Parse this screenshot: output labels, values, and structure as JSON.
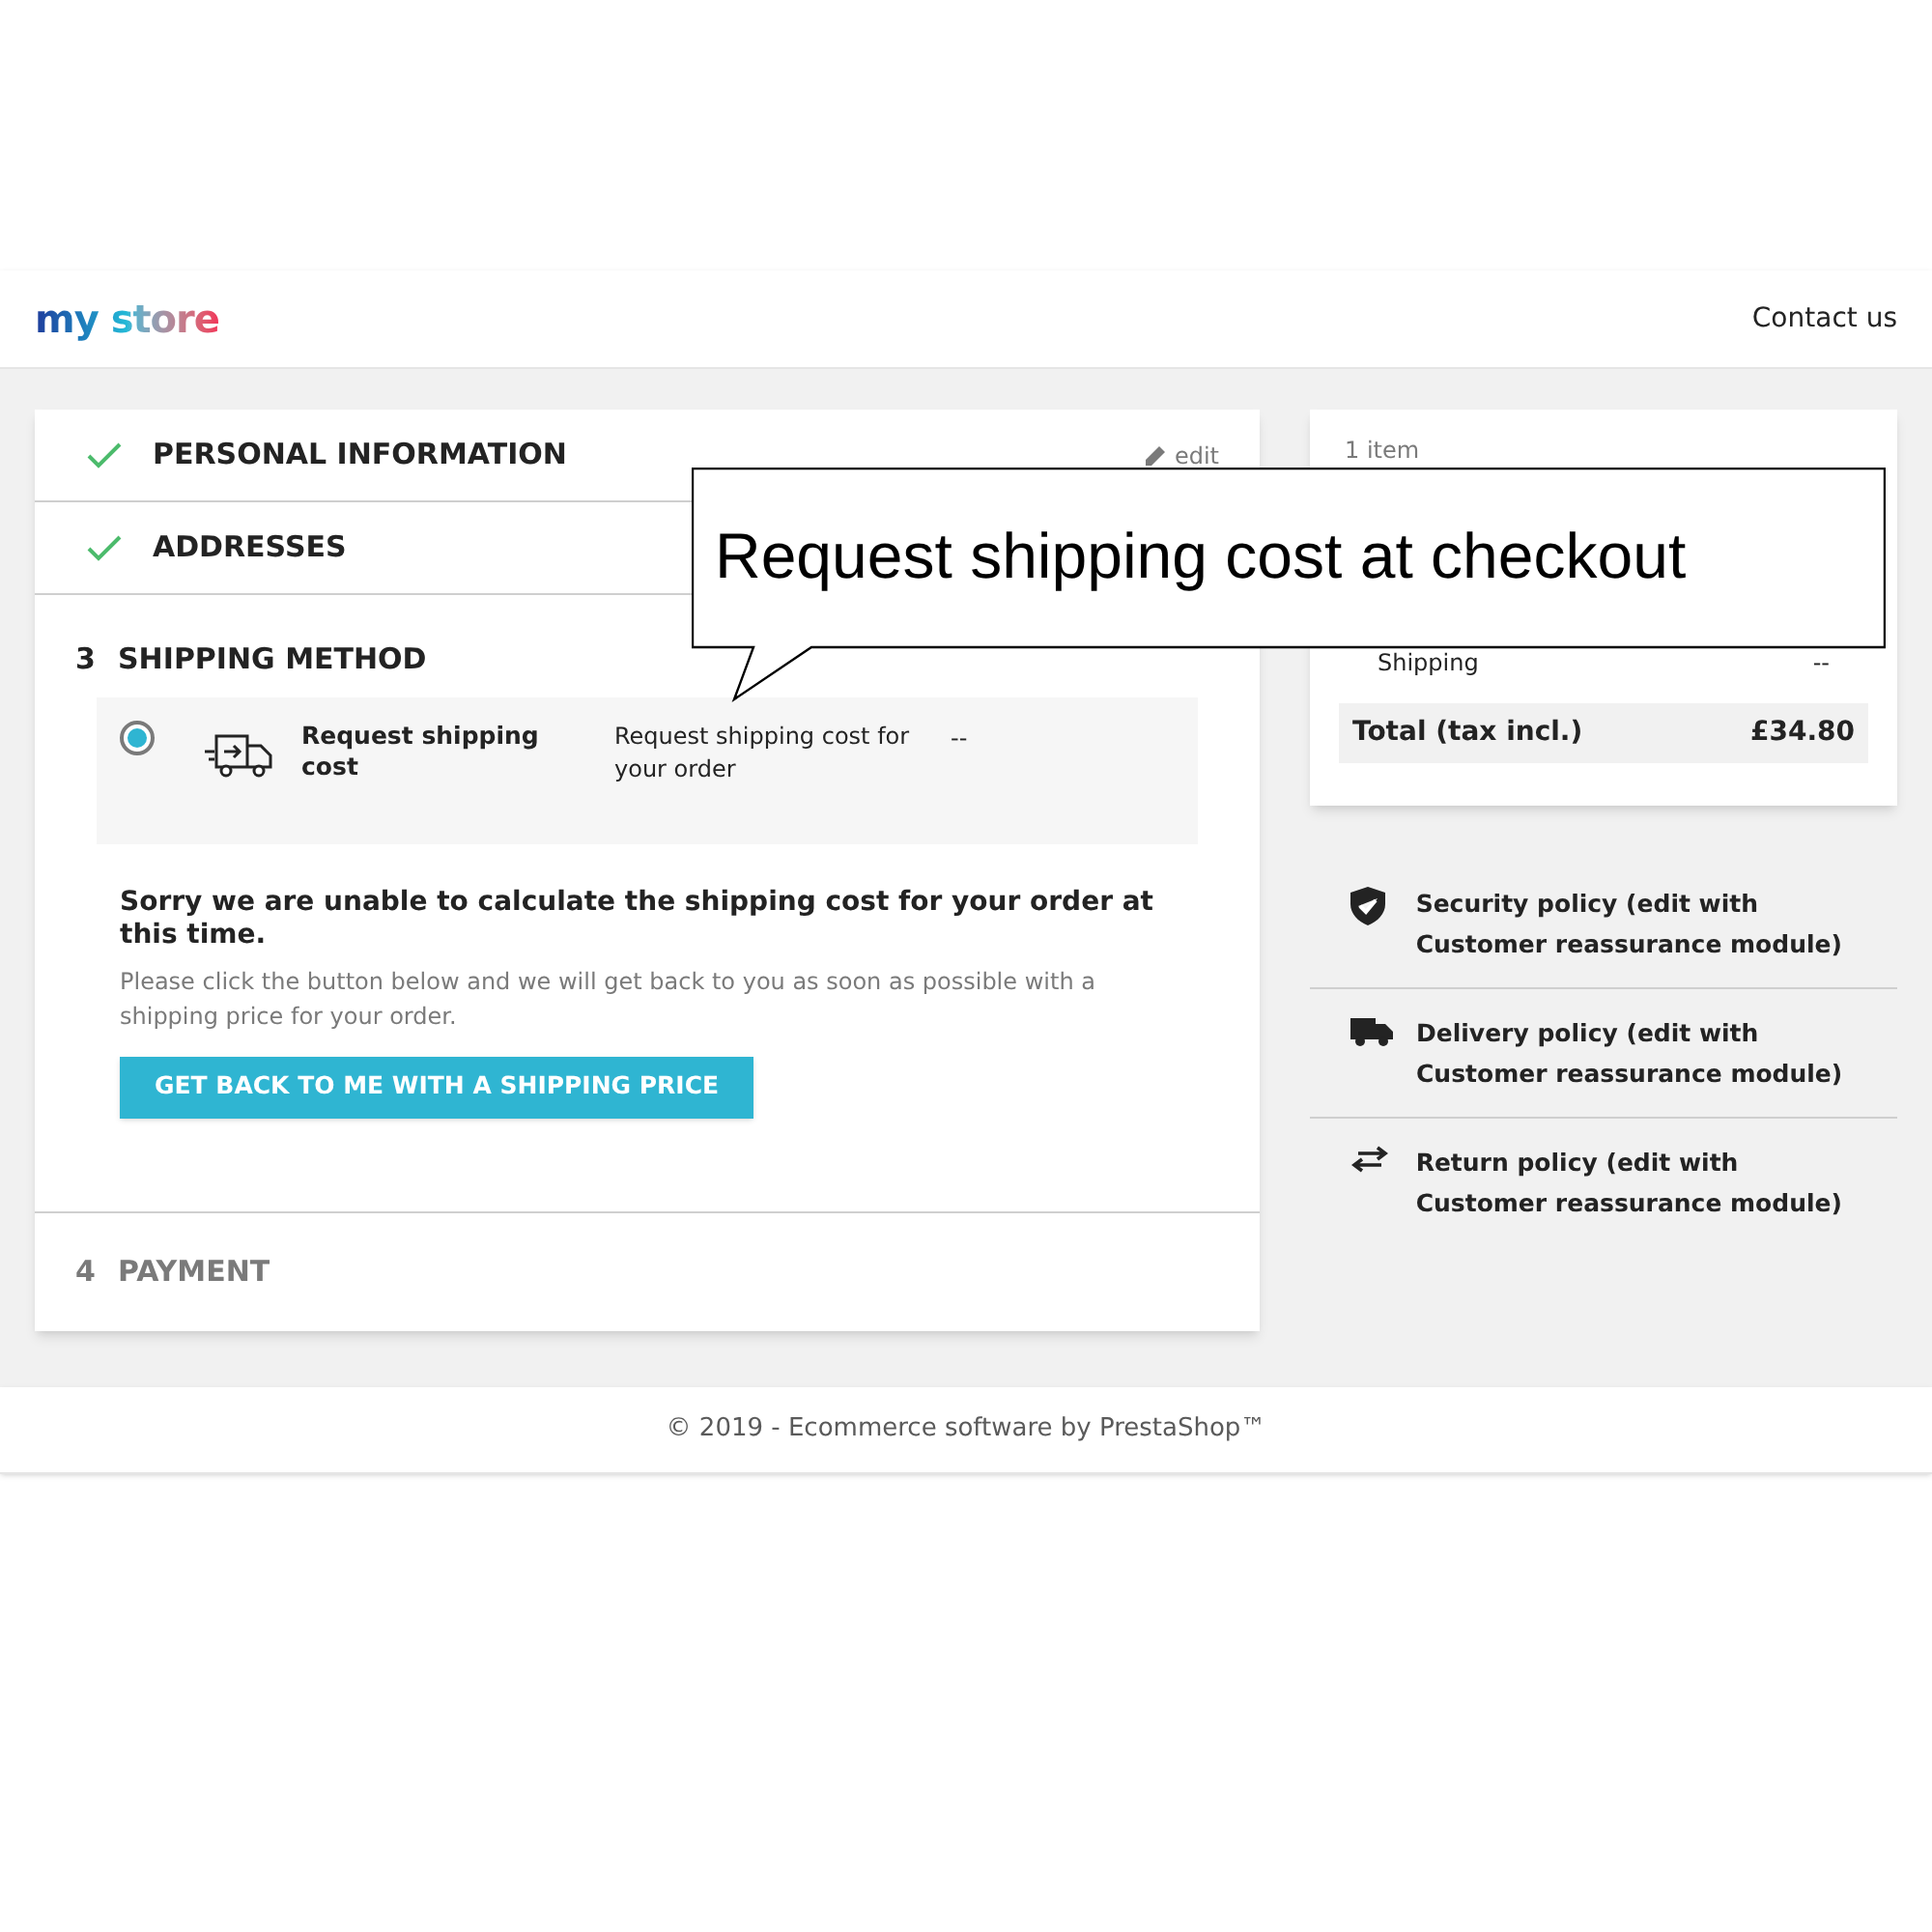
{
  "header": {
    "logo": "my store",
    "nav_link": "Contact us"
  },
  "steps": [
    {
      "title": "PERSONAL INFORMATION",
      "complete": true,
      "expanded": false,
      "disabled": false,
      "edit": "edit"
    },
    {
      "title": "ADDRESSES",
      "complete": true,
      "expanded": false,
      "disabled": false
    },
    {
      "number": "3",
      "title": "SHIPPING METHOD",
      "complete": false,
      "expanded": true,
      "disabled": false
    },
    {
      "number": "4",
      "title": "PAYMENT",
      "complete": false,
      "expanded": false,
      "disabled": true
    }
  ],
  "carrier": {
    "selected": true,
    "name": "Request shipping cost",
    "delay": "Request shipping cost for your order",
    "price": "--"
  },
  "notice": {
    "heading": "Sorry we are unable to calculate the shipping cost for your order at this time.",
    "text": "Please click the button below and we will get back to you as soon as possible with a shipping price for your order.",
    "button": "GET BACK TO ME WITH A SHIPPING PRICE"
  },
  "summary": {
    "items_count": "1 item",
    "shipping_label": "Shipping",
    "shipping_value": "--",
    "total_label": "Total (tax incl.)",
    "total_value": "£34.80"
  },
  "reassurance": [
    {
      "kind": "shield",
      "text": "Security policy (edit with Customer reassurance module)"
    },
    {
      "kind": "truck",
      "text": "Delivery policy (edit with Customer reassurance module)"
    },
    {
      "kind": "arrows",
      "text": "Return policy (edit with Customer reassurance module)"
    }
  ],
  "footer": "© 2019 - Ecommerce software by PrestaShop™",
  "callout": "Request shipping cost at checkout"
}
